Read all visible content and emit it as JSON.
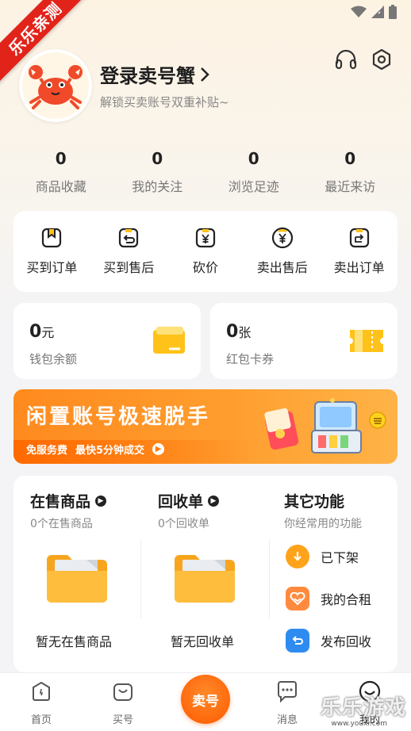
{
  "ribbon": {
    "text": "乐乐亲测"
  },
  "profile": {
    "title": "登录卖号蟹",
    "subtitle": "解锁买卖账号双重补贴~",
    "icons": [
      "headset-icon",
      "settings-icon"
    ]
  },
  "stats": [
    {
      "value": "0",
      "label": "商品收藏"
    },
    {
      "value": "0",
      "label": "我的关注"
    },
    {
      "value": "0",
      "label": "浏览足迹"
    },
    {
      "value": "0",
      "label": "最近来访"
    }
  ],
  "orders": [
    {
      "label": "买到订单",
      "icon": "bookmark-bag-icon"
    },
    {
      "label": "买到售后",
      "icon": "return-bag-icon"
    },
    {
      "label": "砍价",
      "icon": "yen-bag-icon"
    },
    {
      "label": "卖出售后",
      "icon": "yen-circle-icon"
    },
    {
      "label": "卖出订单",
      "icon": "send-bag-icon"
    }
  ],
  "wallet": {
    "value": "0",
    "unit": "元",
    "label": "钱包余额"
  },
  "coupons": {
    "value": "0",
    "unit": "张",
    "label": "红包卡券"
  },
  "banner": {
    "headline": "闲置账号极速脱手",
    "tag1": "免服务费",
    "tag2": "最快5分钟成交"
  },
  "on_sale": {
    "title": "在售商品",
    "sub": "0个在售商品",
    "empty": "暂无在售商品"
  },
  "recycle": {
    "title": "回收单",
    "sub": "0个回收单",
    "empty": "暂无回收单"
  },
  "other": {
    "title": "其它功能",
    "sub": "你经常用的功能",
    "items": [
      {
        "label": "已下架",
        "icon": "download-icon",
        "color": "#ffa31a"
      },
      {
        "label": "我的合租",
        "icon": "heart-link-icon",
        "color": "#ff8a3d"
      },
      {
        "label": "发布回收",
        "icon": "return-icon",
        "color": "#2e8cf0"
      }
    ]
  },
  "tabs": [
    {
      "label": "首页",
      "icon": "home-icon"
    },
    {
      "label": "买号",
      "icon": "bag-icon"
    },
    {
      "label": "卖号",
      "icon": "sell-center-icon"
    },
    {
      "label": "消息",
      "icon": "chat-icon"
    },
    {
      "label": "我的",
      "icon": "profile-icon"
    }
  ],
  "watermark": {
    "text": "乐乐游戏",
    "url": "www.youxi.com"
  }
}
